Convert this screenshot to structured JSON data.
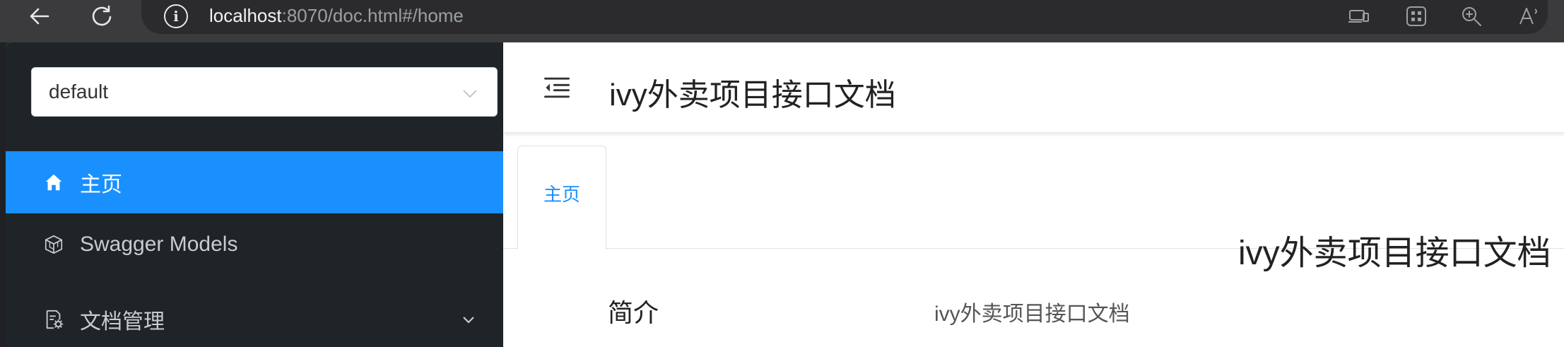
{
  "browser": {
    "url_host": "localhost",
    "url_rest": ":8070/doc.html#/home"
  },
  "sidebar": {
    "group_select": {
      "value": "default"
    },
    "items": [
      {
        "label": "主页",
        "icon": "home-icon",
        "active": true
      },
      {
        "label": "Swagger Models",
        "icon": "cube-icon",
        "active": false
      },
      {
        "label": "文档管理",
        "icon": "document-settings-icon",
        "active": false,
        "expandable": true
      }
    ]
  },
  "header": {
    "title": "ivy外卖项目接口文档"
  },
  "tabs": [
    {
      "label": "主页",
      "active": true
    }
  ],
  "main": {
    "doc_title": "ivy外卖项目接口文档",
    "info_rows": [
      {
        "label": "简介",
        "value": "ivy外卖项目接口文档"
      }
    ]
  },
  "colors": {
    "accent": "#1a90ff",
    "sidebar_bg": "#1f2428",
    "browser_bg": "#3b3b3e"
  }
}
